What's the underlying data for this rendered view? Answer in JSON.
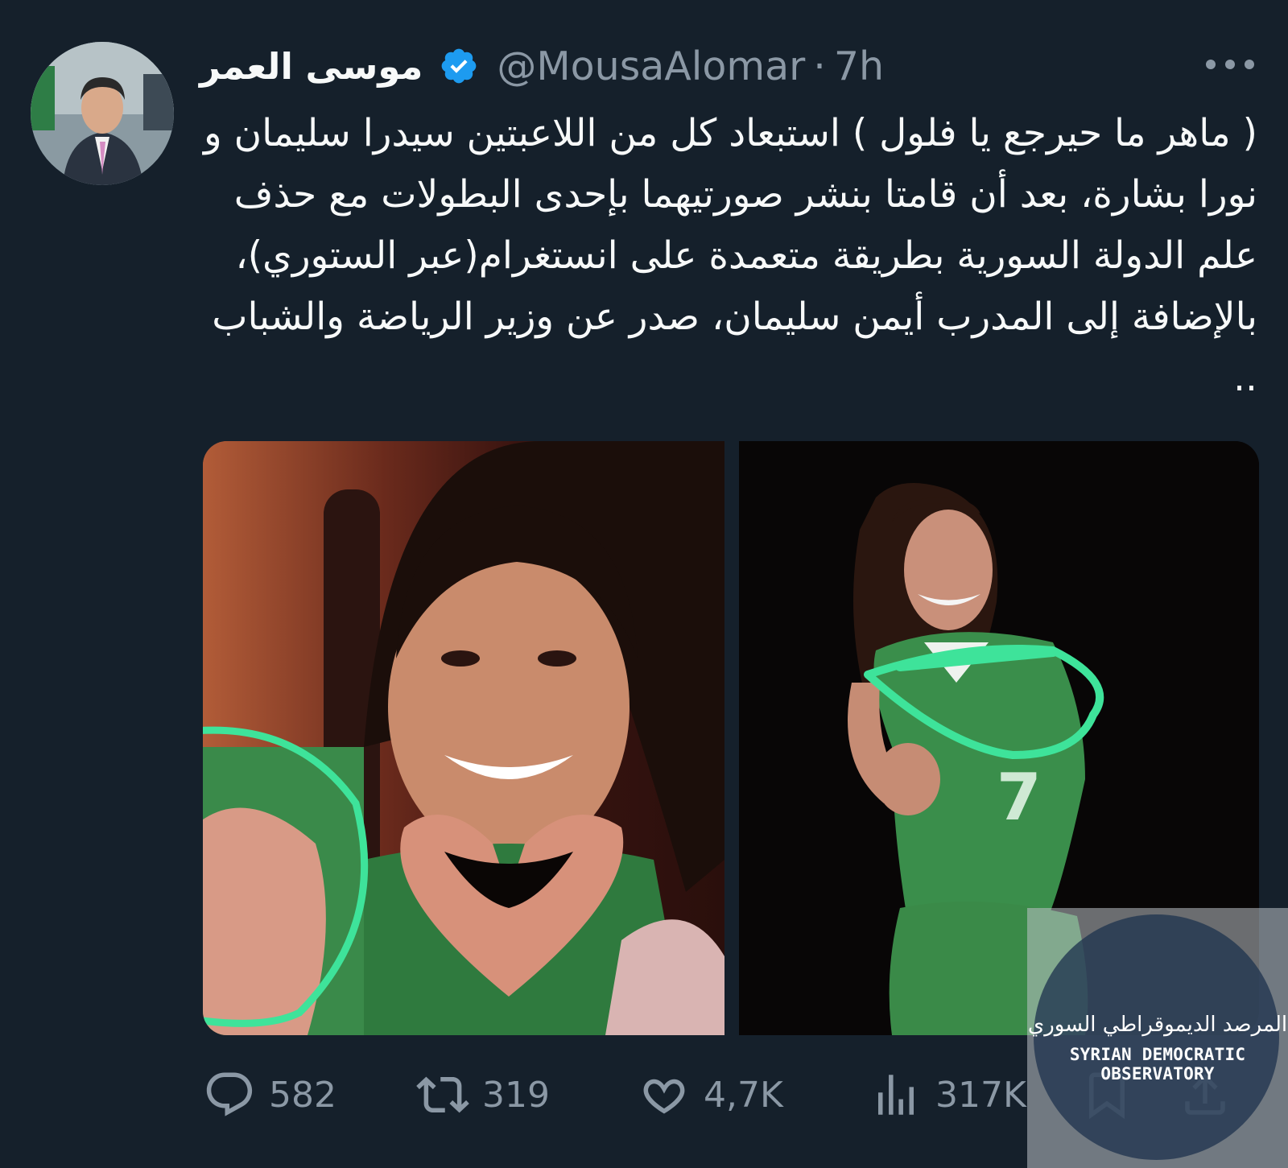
{
  "tweet": {
    "display_name": "موسى العمر",
    "verified": true,
    "handle": "@MousaAlomar",
    "separator": "·",
    "time": "7h",
    "more_icon": "more-horizontal-icon",
    "text": "( ماهر ما حيرجع يا فلول ) استبعاد كل من اللاعبتين سيدرا سليمان و نورا بشارة، بعد أن قامتا بنشر صورتيهما بإحدى البطولات مع حذف علم الدولة السورية بطريقة متعمدة على انستغرام(عبر الستوري)، بالإضافة إلى المدرب أيمن سليمان، صدر عن وزير الرياضة والشباب .."
  },
  "media": {
    "count": 2,
    "annotation_color": "#3ee39a"
  },
  "actions": {
    "reply_count": "582",
    "retweet_count": "319",
    "like_count": "4,7K",
    "views_count": "317K"
  },
  "watermark": {
    "arabic": "المرصد الديموقراطي السوري",
    "english": "SYRIAN DEMOCRATIC OBSERVATORY"
  },
  "colors": {
    "background": "#15202b",
    "text": "#f7f9f9",
    "muted": "#8b98a5",
    "verified": "#1d9bf0"
  }
}
